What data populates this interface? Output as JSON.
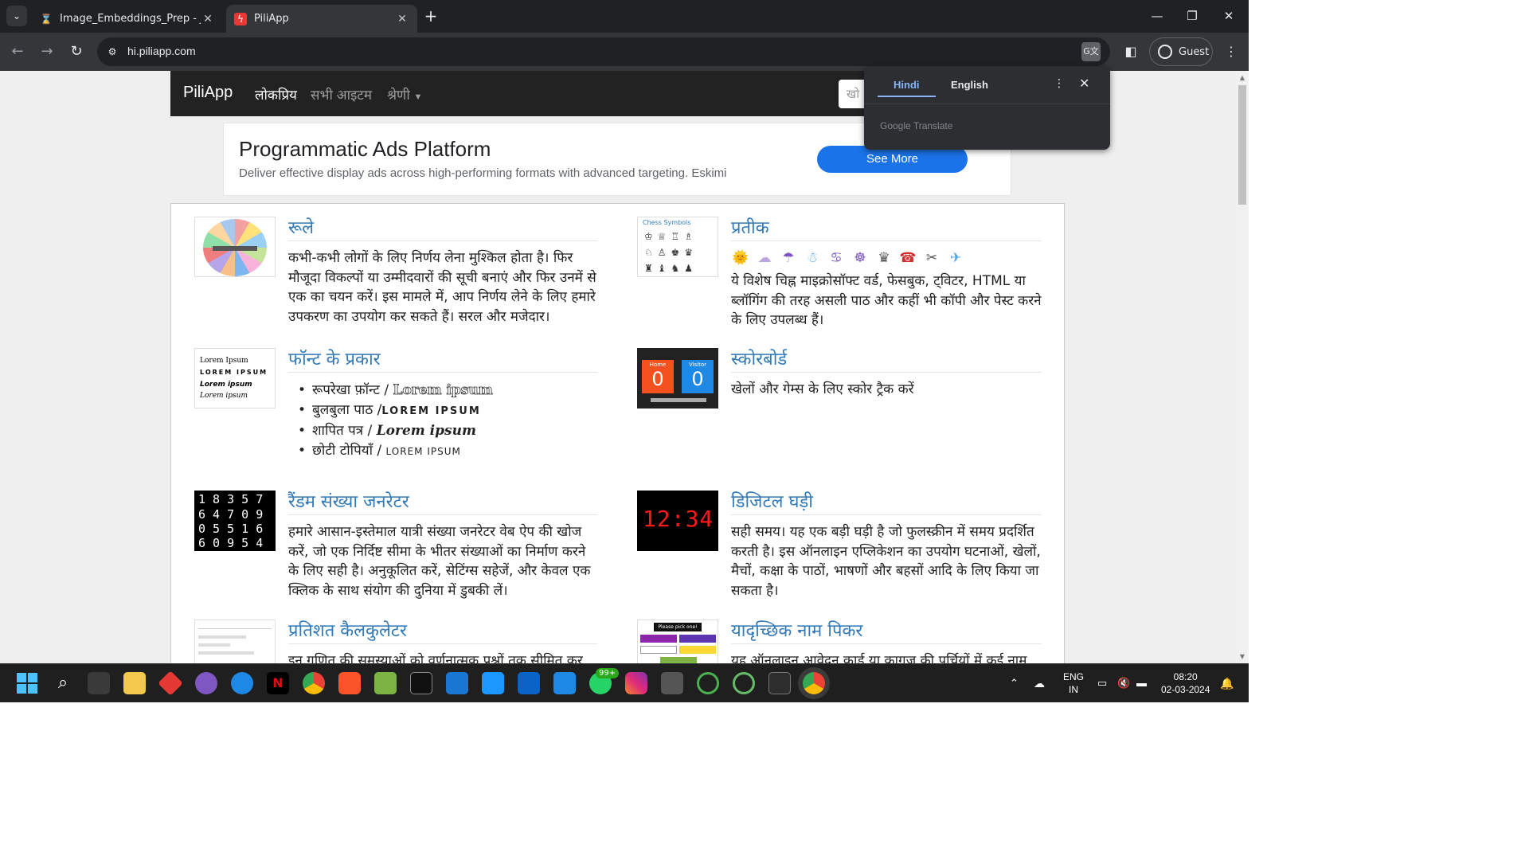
{
  "browser": {
    "tabs": [
      {
        "title": "Image_Embeddings_Prep - Jupyter",
        "favicon": "hourglass-icon"
      },
      {
        "title": "PiliApp",
        "favicon": "piliapp-icon"
      }
    ],
    "url": "hi.piliapp.com",
    "profile": "Guest"
  },
  "site": {
    "brand": "PiliApp",
    "nav": {
      "popular": "लोकप्रिय",
      "all_items": "सभी आइटम",
      "categories": "श्रेणी"
    },
    "search_placeholder": "खो"
  },
  "ad": {
    "title": "Programmatic Ads Platform",
    "description": "Deliver effective display ads across high-performing formats with advanced targeting. Eskimi",
    "button": "See More"
  },
  "cards": {
    "roulette": {
      "title": "रूले",
      "text": "कभी-कभी लोगों के लिए निर्णय लेना मुश्किल होता है। फिर मौजूदा विकल्पों या उम्मीदवारों की सूची बनाएं और फिर उनमें से एक का चयन करें। इस मामले में, आप निर्णय लेने के लिए हमारे उपकरण का उपयोग कर सकते हैं। सरल और मजेदार।"
    },
    "symbols": {
      "title": "प्रतीक",
      "thumb_label": "Chess Symbols",
      "symbols": [
        "🌞",
        "☁",
        "☂",
        "☃",
        "♋",
        "☸",
        "♛",
        "☎",
        "✂",
        "✈"
      ],
      "text": "ये विशेष चिह्न माइक्रोसॉफ्ट वर्ड, फेसबुक, ट्विटर, HTML या ब्लॉगिंग की तरह असली पाठ और कहीं भी कॉपी और पेस्ट करने के लिए उपलब्ध हैं।"
    },
    "fonts": {
      "title": "फॉन्ट के प्रकार",
      "thumb_lines": [
        "Lorem Ipsum",
        "LOREM IPSUM",
        "Lorem ipsum",
        "Lorem ipsum"
      ],
      "items": [
        {
          "label": "रूपरेखा फ़ॉन्ट / ",
          "sample": "Lorem ipsum"
        },
        {
          "label": "बुलबुला पाठ /",
          "sample": "LOREM IPSUM"
        },
        {
          "label": "शापित पत्र / ",
          "sample": "Lorem ipsum"
        },
        {
          "label": "छोटी टोपियाँ / ",
          "sample": "LOREM IPSUM"
        }
      ]
    },
    "scoreboard": {
      "title": "स्कोरबोर्ड",
      "thumb_home": "Home",
      "thumb_visitor": "Visitor",
      "thumb_score_home": "0",
      "thumb_score_visitor": "0",
      "text": "खेलों और गेम्स के लिए स्कोर ट्रैक करें"
    },
    "random_number": {
      "title": "रैंडम संख्या जनरेटर",
      "thumb_rows": [
        "1 8 3 5 7",
        "6 4 7 0 9",
        "0 5 5 1 6",
        "6 0 9 5 4"
      ],
      "text": "हमारे आसान-इस्तेमाल यात्री संख्या जनरेटर वेब ऐप की खोज करें, जो एक निर्दिष्ट सीमा के भीतर संख्याओं का निर्माण करने के लिए सही है। अनुकूलित करें, सेटिंग्स सहेजें, और केवल एक क्लिक के साथ संयोग की दुनिया में डुबकी लें।"
    },
    "digital_clock": {
      "title": "डिजिटल घड़ी",
      "thumb_time": "12:34",
      "text": "सही समय। यह एक बड़ी घड़ी है जो फुलस्क्रीन में समय प्रदर्शित करती है। इस ऑनलाइन एप्लिकेशन का उपयोग घटनाओं, खेलों, मैचों, कक्षा के पाठों, भाषणों और बहसों आदि के लिए किया जा सकता है।"
    },
    "percent": {
      "title": "प्रतिशत कैलकुलेटर",
      "text": "इन गणित की समस्याओं को वर्णनात्मक प्रश्नों तक सीमित कर"
    },
    "name_picker": {
      "title": "यादृच्छिक नाम पिकर",
      "thumb_label": "Please pick one!",
      "text": "यह ऑनलाइन आवेदन कार्ड या कागज की पर्चियों में कई नाम"
    }
  },
  "translate_popup": {
    "tab_hindi": "Hindi",
    "tab_english": "English",
    "brand": "Google Translate"
  },
  "taskbar": {
    "language": "ENG",
    "region": "IN",
    "time": "08:20",
    "date": "02-03-2024",
    "whatsapp_badge": "99+"
  },
  "colors": {
    "link_blue": "#337ab7",
    "ad_button": "#1a73e8",
    "navbar": "#222222",
    "translate_accent": "#8ab4f8"
  }
}
